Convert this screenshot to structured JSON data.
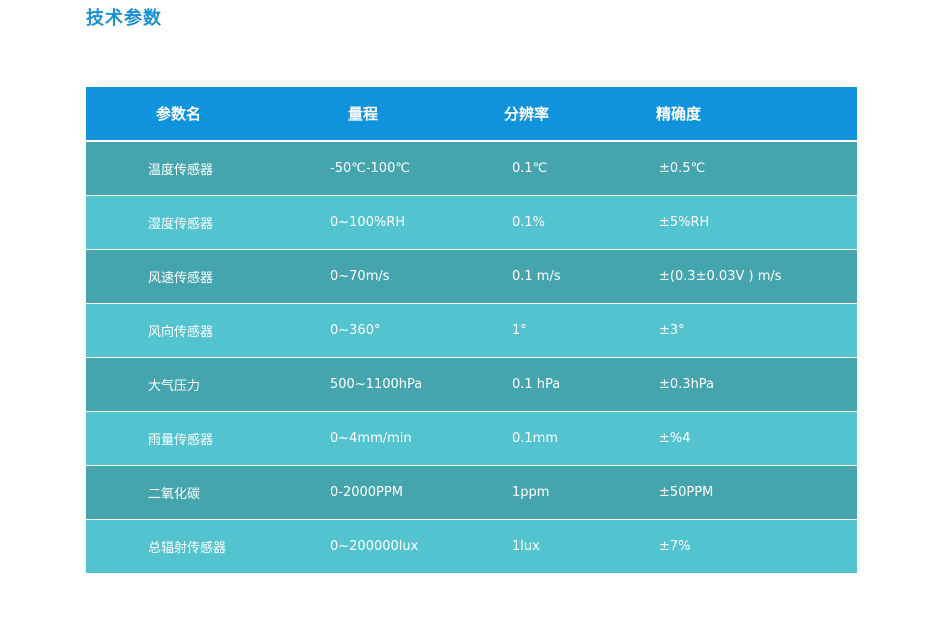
{
  "page": {
    "title": "技术参数"
  },
  "table": {
    "headers": [
      "参数名",
      "量程",
      "分辨率",
      "精确度"
    ],
    "rows": [
      [
        "温度传感器",
        "-50℃-100℃",
        "0.1℃",
        "±0.5℃"
      ],
      [
        "湿度传感器",
        "0~100%RH",
        "0.1%",
        "±5%RH"
      ],
      [
        "风速传感器",
        "0~70m/s",
        "0.1 m/s",
        "±(0.3±0.03V ) m/s"
      ],
      [
        "风向传感器",
        "0~360°",
        "1°",
        "±3°"
      ],
      [
        "大气压力",
        "500~1100hPa",
        "0.1 hPa",
        "±0.3hPa"
      ],
      [
        "雨量传感器",
        "0~4mm/min",
        "0.1mm",
        "±%4"
      ],
      [
        "二氧化碳",
        "0-2000PPM",
        "1ppm",
        "±50PPM"
      ],
      [
        "总辐射传感器",
        "0~200000lux",
        "1lux",
        "±7%"
      ]
    ],
    "colors": {
      "header_bg": "#0f93dc",
      "row_dark": "#45a5ae",
      "row_light": "#53c3d0",
      "title": "#1a8fd3"
    }
  }
}
